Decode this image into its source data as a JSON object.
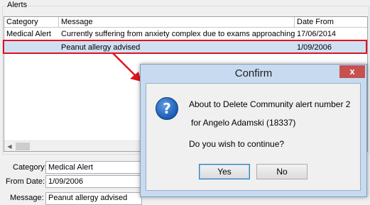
{
  "alerts": {
    "group_label": "Alerts",
    "columns": [
      "Category",
      "Message",
      "Date From"
    ],
    "rows": [
      {
        "category": "Medical Alert",
        "message": "Currently suffering from anxiety complex due to exams approaching",
        "date_from": "17/06/2014"
      },
      {
        "category": "",
        "message": "Peanut allergy advised",
        "date_from": "1/09/2006"
      }
    ]
  },
  "details": {
    "category_label": "Category:",
    "category_value": "Medical Alert",
    "from_date_label": "From Date:",
    "from_date_value": "1/09/2006",
    "message_label": "Message:",
    "message_value": "Peanut allergy advised"
  },
  "dialog": {
    "title": "Confirm",
    "close_glyph": "x",
    "icon_glyph": "?",
    "line1": "About to Delete Community alert number 2",
    "line2": "for Angelo Adamski (18337)",
    "line3": "Do you wish to continue?",
    "yes_label": "Yes",
    "no_label": "No"
  },
  "colors": {
    "highlight": "#e0141e",
    "selected_row": "#cfe0f3",
    "dialog_frame": "#c7daf0",
    "close_button": "#c75050"
  }
}
